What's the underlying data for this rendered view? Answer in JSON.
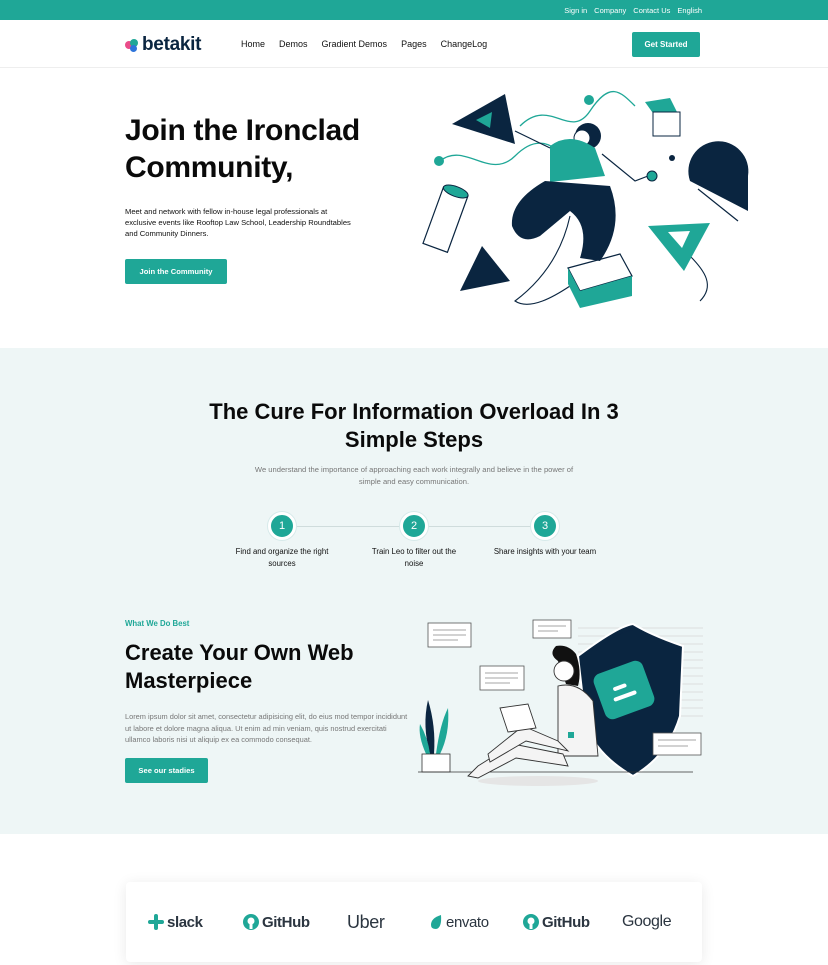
{
  "topbar": {
    "links": [
      "Sign in",
      "Company",
      "Contact Us",
      "English"
    ]
  },
  "header": {
    "logo_text": "betakit",
    "menu": [
      "Home",
      "Demos",
      "Gradient Demos",
      "Pages",
      "ChangeLog"
    ],
    "cta_label": "Get Started"
  },
  "hero": {
    "title": "Join the Ironclad Community,",
    "description": "Meet and network with fellow in-house legal professionals at exclusive events like Rooftop Law School, Leadership Roundtables and Community Dinners.",
    "cta_label": "Join the Community"
  },
  "steps": {
    "title": "The Cure For Information Overload In 3 Simple Steps",
    "subtitle": "We understand the importance of approaching each work integrally and believe in the power of simple and easy communication.",
    "items": [
      {
        "number": "1",
        "label": "Find and organize the right sources"
      },
      {
        "number": "2",
        "label": "Train Leo to filter out the noise"
      },
      {
        "number": "3",
        "label": "Share insights with your team"
      }
    ]
  },
  "feature": {
    "eyebrow": "What We Do Best",
    "title": "Create Your Own Web Masterpiece",
    "description": "Lorem ipsum dolor sit amet, consectetur adipisicing elit, do eius mod tempor incididunt ut labore et dolore magna aliqua. Ut enim ad min veniam, quis nostrud exercitati ullamco laboris nisi ut aliquip ex ea commodo consequat.",
    "cta_label": "See our stadies"
  },
  "brands": {
    "items": [
      "slack",
      "GitHub",
      "Uber",
      "envato",
      "GitHub",
      "Google"
    ]
  },
  "colors": {
    "accent": "#1fa797",
    "dark_navy": "#0a2540",
    "section_bg": "#eef6f6"
  }
}
